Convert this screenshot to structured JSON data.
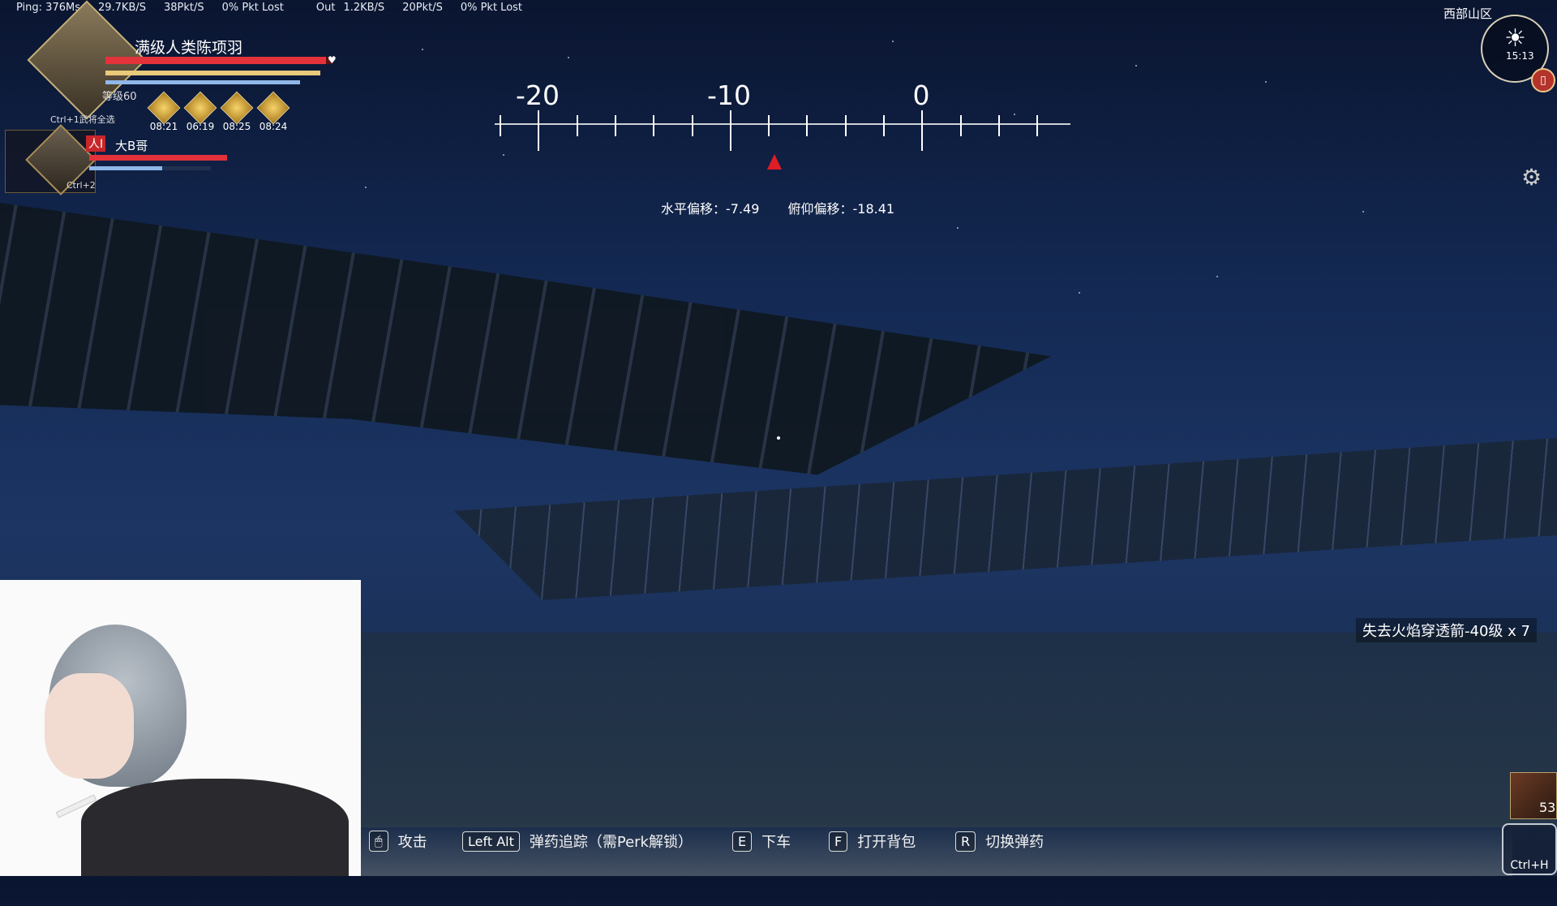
{
  "netstats": {
    "ping": "Ping: 376Ms",
    "in_rate": "29.7KB/S",
    "in_pkt": "38Pkt/S",
    "in_lost": "0% Pkt Lost",
    "out_label": "Out",
    "out_rate": "1.2KB/S",
    "out_pkt": "20Pkt/S",
    "out_lost": "0% Pkt Lost"
  },
  "player": {
    "name": "满级人类陈项羽",
    "level": "等级60",
    "shortcut": "Ctrl+1武将全选",
    "hp_fraction": 0.97,
    "buffs": [
      {
        "icon": "buff-icon",
        "time": "08:21"
      },
      {
        "icon": "buff-icon",
        "time": "06:19"
      },
      {
        "icon": "buff-icon",
        "time": "08:25"
      },
      {
        "icon": "buff-icon",
        "time": "08:24"
      }
    ]
  },
  "companion": {
    "badge": "人Ⅰ",
    "name": "大B哥",
    "shortcut": "Ctrl+2"
  },
  "compass": {
    "labels": [
      "-20",
      "-10",
      "0"
    ]
  },
  "aim": {
    "horizontal": "水平偏移：-7.49",
    "vertical": "俯仰偏移：-18.41"
  },
  "region": "西部山区",
  "clock_time": "15:13",
  "notification": "失去火焰穿透箭-40级 x 7",
  "ammo_count": "53",
  "hotkeys": [
    {
      "key": "",
      "label": "攻击"
    },
    {
      "key": "Left Alt",
      "label": "弹药追踪（需Perk解锁）"
    },
    {
      "key": "E",
      "label": "下车"
    },
    {
      "key": "F",
      "label": "打开背包"
    },
    {
      "key": "R",
      "label": "切换弹药"
    }
  ],
  "ctrl_h": "Ctrl+H"
}
